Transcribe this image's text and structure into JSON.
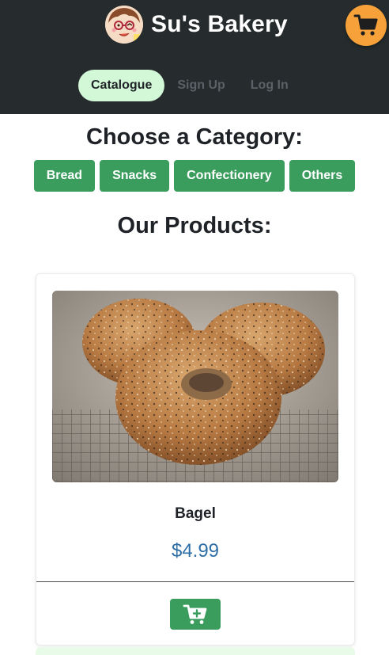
{
  "header": {
    "brand_name": "Su's Bakery",
    "background": "#262c2d"
  },
  "cart": {
    "icon": "shopping-cart-icon",
    "color": "#f7a13b"
  },
  "nav": {
    "items": [
      {
        "label": "Catalogue",
        "active": true
      },
      {
        "label": "Sign Up",
        "active": false
      },
      {
        "label": "Log In",
        "active": false
      }
    ]
  },
  "category_section": {
    "title": "Choose a Category:",
    "categories": [
      "Bread",
      "Snacks",
      "Confectionery",
      "Others"
    ],
    "button_color": "#3a9d5d"
  },
  "products_section": {
    "title": "Our Products:",
    "products": [
      {
        "name": "Bagel",
        "price": "$4.99",
        "image": "bagel-photo",
        "add_icon": "cart-plus-icon"
      }
    ]
  },
  "colors": {
    "accent_green": "#3a9d5d",
    "active_nav": "#d3f8d7",
    "price_blue": "#2e6ea6"
  }
}
